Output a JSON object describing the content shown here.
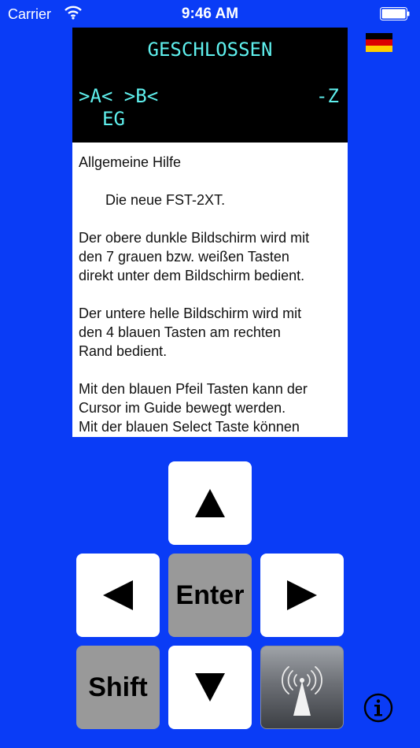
{
  "status_bar": {
    "carrier": "Carrier",
    "time": "9:46 AM"
  },
  "lcd": {
    "line1": "GESCHLOSSEN",
    "line2_left": ">A< >B<",
    "line2_right": "-Z",
    "line3": "EG"
  },
  "help": {
    "title": "Allgemeine Hilfe",
    "intro": "Die neue FST-2XT.",
    "para1": [
      "Der obere dunkle Bildschirm wird mit",
      "den 7 grauen bzw. weißen Tasten",
      "direkt unter dem Bildschirm bedient."
    ],
    "para2": [
      "Der untere helle Bildschirm wird mit",
      "den 4 blauen Tasten am rechten",
      "Rand bedient."
    ],
    "para3": [
      "Mit den blauen Pfeil Tasten kann der",
      "Cursor im Guide bewegt werden.",
      "Mit der blauen Select Taste können"
    ]
  },
  "keys": {
    "enter": "Enter",
    "shift": "Shift"
  },
  "icons": {
    "flag": "german-flag-icon",
    "up": "arrow-up-icon",
    "down": "arrow-down-icon",
    "left": "arrow-left-icon",
    "right": "arrow-right-icon",
    "radio": "radio-antenna-icon",
    "info": "info-icon"
  },
  "colors": {
    "background": "#0a3cf6",
    "lcd_text": "#5ff0ee",
    "lcd_bg": "#000000"
  }
}
